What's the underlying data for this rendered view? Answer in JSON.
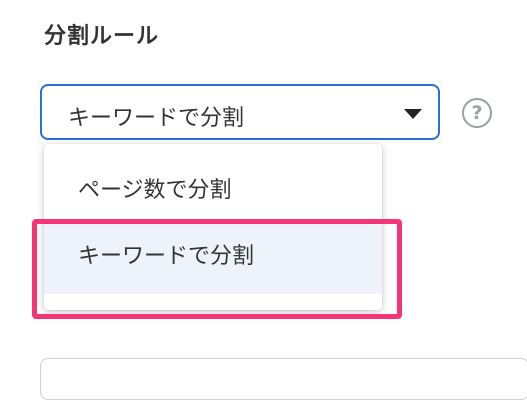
{
  "section": {
    "title": "分割ルール"
  },
  "select": {
    "value": "キーワードで分割",
    "help_label": "?"
  },
  "menu": {
    "options": [
      {
        "label": "ページ数で分割"
      },
      {
        "label": "キーワードで分割"
      }
    ]
  },
  "colors": {
    "accent": "#2d6fd2",
    "highlight": "#f43675",
    "selected_bg": "#eef3fb"
  }
}
